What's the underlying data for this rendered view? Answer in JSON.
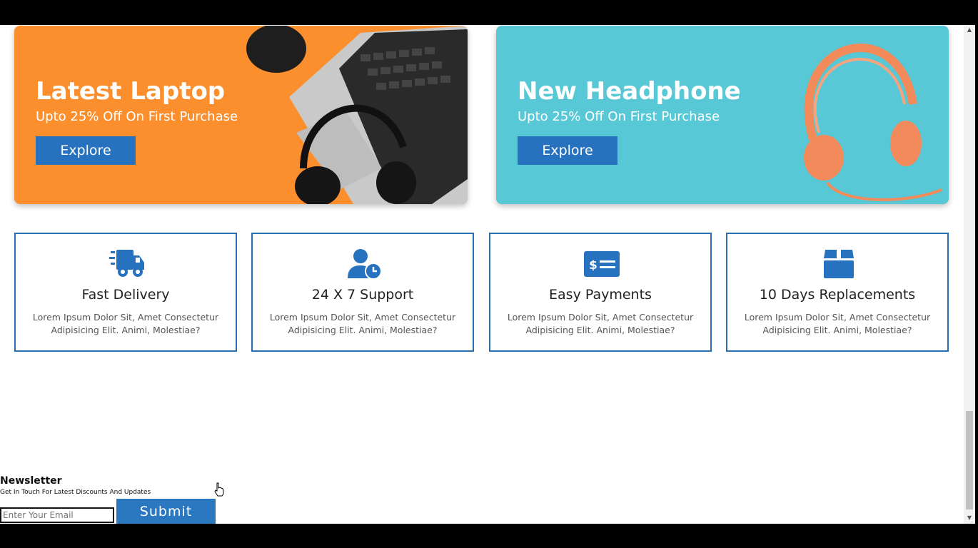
{
  "banners": [
    {
      "title": "Latest Laptop",
      "subtitle": "Upto 25% Off On First Purchase",
      "button": "Explore",
      "color": "#fb8f2e"
    },
    {
      "title": "New Headphone",
      "subtitle": "Upto 25% Off On First Purchase",
      "button": "Explore",
      "color": "#58c8d6"
    }
  ],
  "features": [
    {
      "icon": "truck-icon",
      "title": "Fast Delivery",
      "desc": "Lorem Ipsum Dolor Sit, Amet Consectetur Adipisicing Elit. Animi, Molestiae?"
    },
    {
      "icon": "user-clock-icon",
      "title": "24 X 7 Support",
      "desc": "Lorem Ipsum Dolor Sit, Amet Consectetur Adipisicing Elit. Animi, Molestiae?"
    },
    {
      "icon": "money-check-icon",
      "title": "Easy Payments",
      "desc": "Lorem Ipsum Dolor Sit, Amet Consectetur Adipisicing Elit. Animi, Molestiae?"
    },
    {
      "icon": "box-icon",
      "title": "10 Days Replacements",
      "desc": "Lorem Ipsum Dolor Sit, Amet Consectetur Adipisicing Elit. Animi, Molestiae?"
    }
  ],
  "newsletter": {
    "title": "Newsletter",
    "subtitle": "Get In Touch For Latest Discounts And Updates",
    "placeholder": "Enter Your Email",
    "submit": "Submit"
  },
  "colors": {
    "accent": "#2672bf",
    "border": "#2b6fb0"
  }
}
